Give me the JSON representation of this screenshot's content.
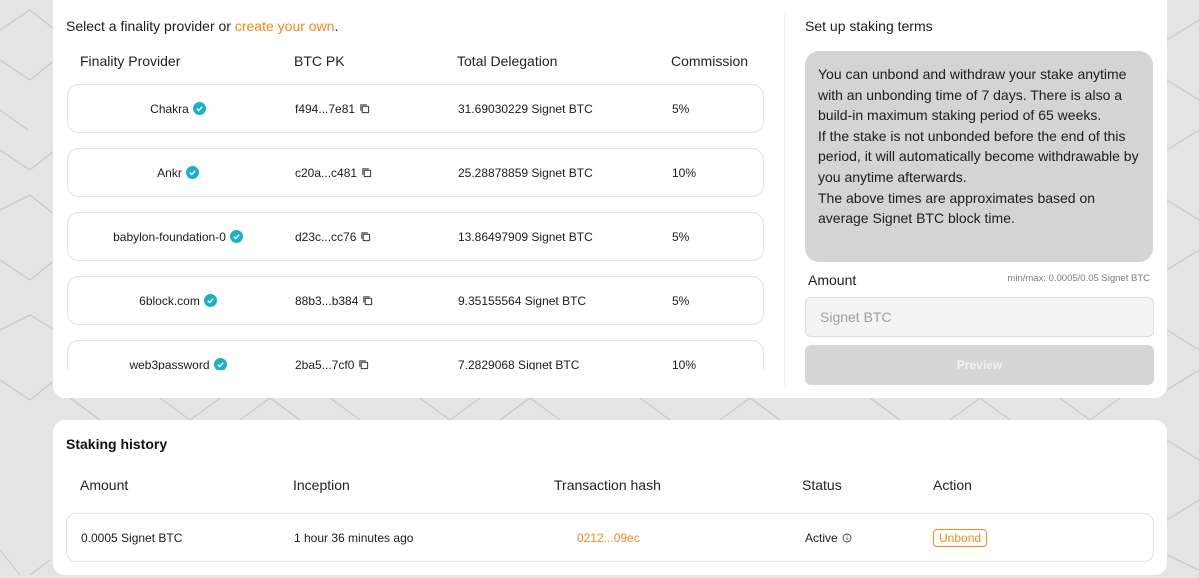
{
  "provider_select": {
    "prefix": "Select a finality provider or ",
    "link": "create your own",
    "suffix": "."
  },
  "provider_table": {
    "columns": [
      "Finality Provider",
      "BTC PK",
      "Total Delegation",
      "Commission"
    ],
    "rows": [
      {
        "name": "Chakra",
        "pk": "f494...7e81",
        "delegation": "31.69030229 Signet BTC",
        "commission": "5%"
      },
      {
        "name": "Ankr",
        "pk": "c20a...c481",
        "delegation": "25.28878859 Signet BTC",
        "commission": "10%"
      },
      {
        "name": "babylon-foundation-0",
        "pk": "d23c...cc76",
        "delegation": "13.86497909 Signet BTC",
        "commission": "5%"
      },
      {
        "name": "6block.com",
        "pk": "88b3...b384",
        "delegation": "9.35155564 Signet BTC",
        "commission": "5%"
      },
      {
        "name": "web3password",
        "pk": "2ba5...7cf0",
        "delegation": "7.2829068 Signet BTC",
        "commission": "10%"
      }
    ]
  },
  "staking_terms": {
    "title": "Set up staking terms",
    "info": [
      "You can unbond and withdraw your stake anytime with an unbonding time of 7 days. There is also a build-in maximum staking period of 65 weeks.",
      "If the stake is not unbonded before the end of this period, it will automatically become withdrawable by you anytime afterwards.",
      "The above times are approximates based on average Signet BTC block time."
    ],
    "amount_label": "Amount",
    "minmax": "min/max: 0.0005/0.05 Signet BTC",
    "amount_placeholder": "Signet BTC",
    "amount_value": "",
    "preview_label": "Preview"
  },
  "staking_history": {
    "title": "Staking history",
    "columns": [
      "Amount",
      "Inception",
      "Transaction hash",
      "Status",
      "Action"
    ],
    "rows": [
      {
        "amount": "0.0005 Signet BTC",
        "inception": "1 hour 36 minutes ago",
        "tx_hash": "0212...09ec",
        "status": "Active",
        "action": "Unbond"
      }
    ]
  },
  "colors": {
    "accent": "#f7861e",
    "verified": "#1bb0c8",
    "terms_box": "#d4d4d4",
    "background": "#e4e4e4"
  },
  "icons": {
    "verified": "verified-check-icon",
    "copy": "copy-icon",
    "status_info": "info-icon"
  }
}
